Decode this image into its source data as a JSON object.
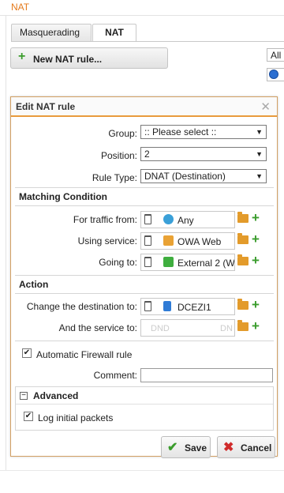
{
  "window": {
    "title": "NAT"
  },
  "tabs": [
    {
      "label": "Masquerading",
      "active": false
    },
    {
      "label": "NAT",
      "active": true
    }
  ],
  "toolbar": {
    "new_rule_label": "New NAT rule...",
    "filter_value": "All"
  },
  "dialog": {
    "title": "Edit NAT rule",
    "group": {
      "label": "Group:",
      "value": ":: Please select ::"
    },
    "position": {
      "label": "Position:",
      "value": "2"
    },
    "rule_type": {
      "label": "Rule Type:",
      "value": "DNAT (Destination)"
    },
    "matching": {
      "title": "Matching Condition",
      "from": {
        "label": "For traffic from:",
        "value": "Any",
        "icon": "globe-icon"
      },
      "service": {
        "label": "Using service:",
        "value": "OWA Web",
        "icon": "service-icon"
      },
      "going_to": {
        "label": "Going to:",
        "value": "External 2 (W",
        "icon": "interface-icon"
      }
    },
    "action": {
      "title": "Action",
      "dest": {
        "label": "Change the destination to:",
        "value": "DCEZI1",
        "icon": "host-icon"
      },
      "service_to": {
        "label": "And the service to:",
        "placeholder_left": "DND",
        "placeholder_right": "DN"
      }
    },
    "auto_firewall": {
      "label": "Automatic Firewall rule",
      "checked": true
    },
    "comment": {
      "label": "Comment:",
      "value": ""
    },
    "advanced": {
      "title": "Advanced",
      "log_initial": {
        "label": "Log initial packets",
        "checked": true
      }
    },
    "save_label": "Save",
    "cancel_label": "Cancel"
  },
  "colors": {
    "accent": "#e99b3d",
    "add_green": "#3a9c2c",
    "cancel_red": "#d02b2b",
    "title_orange": "#e57a1c"
  }
}
